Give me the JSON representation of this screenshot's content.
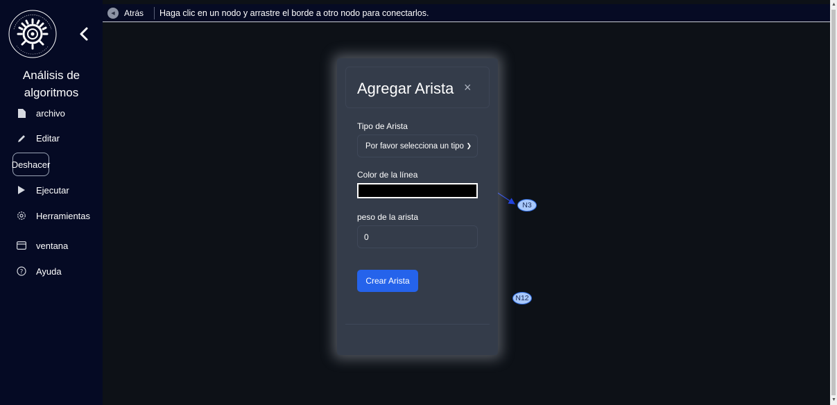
{
  "sidebar": {
    "title": "Análisis de algoritmos",
    "items": [
      {
        "label": "archivo",
        "icon": "file-icon"
      },
      {
        "label": "Editar",
        "icon": "pencil-icon"
      },
      {
        "label": "Ejecutar",
        "icon": "play-icon"
      },
      {
        "label": "Herramientas",
        "icon": "gear-icon"
      },
      {
        "label": "ventana",
        "icon": "window-icon"
      },
      {
        "label": "Ayuda",
        "icon": "help-icon"
      }
    ],
    "undo_label": "Deshacer"
  },
  "topbar": {
    "back_label": "Atrás",
    "hint": "Haga clic en un nodo y arrastre el borde a otro nodo para conectarlos."
  },
  "modal": {
    "title": "Agregar Arista",
    "close": "×",
    "edge_type_label": "Tipo de Arista",
    "edge_type_value": "Por favor selecciona un tipo",
    "color_label": "Color de la línea",
    "color_value": "#000000",
    "weight_label": "peso de la arista",
    "weight_value": "0",
    "create_label": "Crear Arista"
  },
  "graph": {
    "nodes": [
      {
        "id": "N3",
        "label": "N3"
      },
      {
        "id": "N12",
        "label": "N12"
      }
    ],
    "edge_color": "#1f3fdc",
    "node_fill": "#a8c8fb"
  }
}
